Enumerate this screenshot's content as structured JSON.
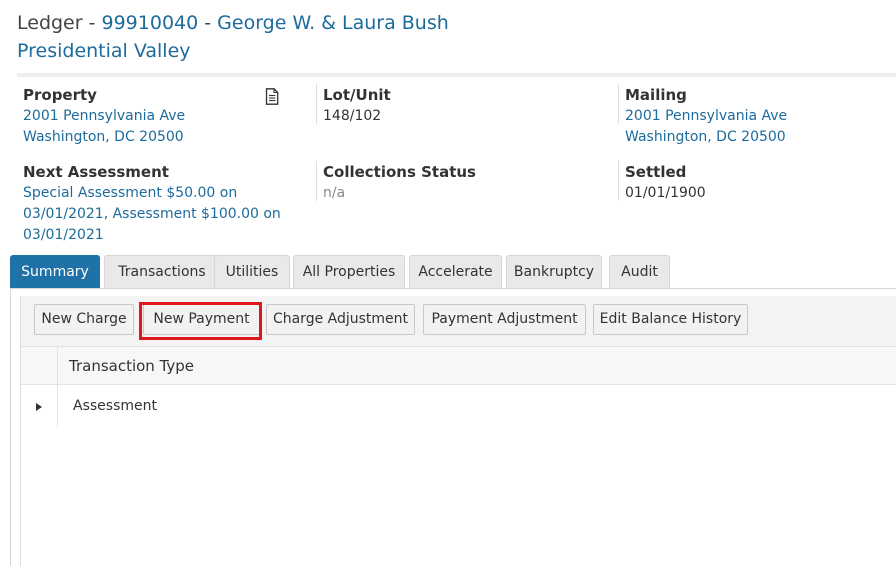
{
  "header": {
    "ledger_label": "Ledger - ",
    "account_number": "99910040",
    "separator": " - ",
    "owner_name": "George W. & Laura Bush",
    "community": "Presidential Valley"
  },
  "info": {
    "property": {
      "label": "Property",
      "line1": "2001 Pennsylvania Ave",
      "line2": "Washington, DC 20500"
    },
    "lot_unit": {
      "label": "Lot/Unit",
      "value": "148/102"
    },
    "mailing": {
      "label": "Mailing",
      "line1": "2001 Pennsylvania Ave",
      "line2": "Washington, DC 20500"
    },
    "next_assessment": {
      "label": "Next Assessment",
      "line1": "Special Assessment $50.00 on",
      "line2": "03/01/2021, Assessment $100.00 on",
      "line3": "03/01/2021"
    },
    "collections_status": {
      "label": "Collections Status",
      "value": "n/a"
    },
    "settled": {
      "label": "Settled",
      "value": "01/01/1900"
    }
  },
  "tabs": [
    {
      "label": "Summary",
      "active": true
    },
    {
      "label": "Transactions"
    },
    {
      "label": "Utilities"
    },
    {
      "label": "All Properties"
    },
    {
      "label": "Accelerate"
    },
    {
      "label": "Bankruptcy"
    },
    {
      "label": "Audit"
    }
  ],
  "toolbar": {
    "new_charge": "New Charge",
    "new_payment": "New Payment",
    "charge_adjustment": "Charge Adjustment",
    "payment_adjustment": "Payment Adjustment",
    "edit_balance_history": "Edit Balance History"
  },
  "grid": {
    "column_header": "Transaction Type",
    "rows": [
      {
        "type": "Assessment"
      }
    ]
  },
  "colors": {
    "link": "#1c6b9c",
    "active_tab": "#1e72a8",
    "highlight": "#e0161e"
  },
  "icons": {
    "property_doc": "document-icon",
    "row_expander": "caret-right-icon"
  }
}
